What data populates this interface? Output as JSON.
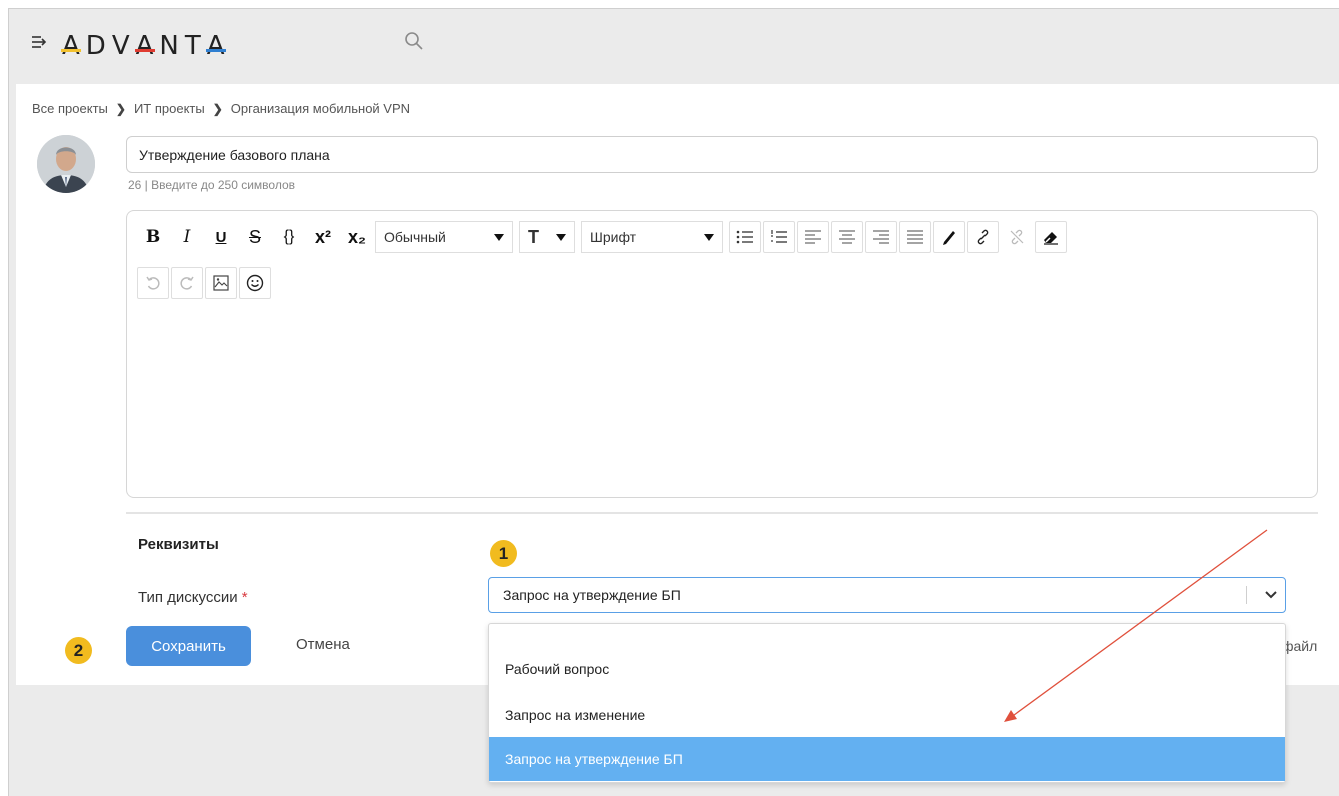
{
  "app": {
    "logo_text": "ADVANTA",
    "logo_letters": [
      "A",
      "D",
      "V",
      "A",
      "N",
      "T",
      "A"
    ]
  },
  "breadcrumb": {
    "items": [
      "Все проекты",
      "ИТ проекты",
      "Организация мобильной VPN"
    ],
    "separator": "❯"
  },
  "form": {
    "title_value": "Утверждение базового плана",
    "counter_text": "26 | Введите до 250 символов"
  },
  "editor": {
    "toolbar": {
      "bold": "B",
      "italic": "I",
      "underline": "U",
      "strike": "S",
      "code": "{}",
      "superscript": "x²",
      "subscript": "x₂",
      "paragraph_select": "Обычный",
      "font_size_label": "T",
      "font_select": "Шрифт"
    }
  },
  "requisites": {
    "heading": "Реквизиты",
    "type_label": "Тип дискуссии",
    "required_mark": "*",
    "type_value": "Запрос на утверждение БП"
  },
  "dropdown": {
    "options": [
      "Рабочий вопрос",
      "Запрос на изменение",
      "Запрос на утверждение БП"
    ],
    "selected_index": 2
  },
  "actions": {
    "save_label": "Сохранить",
    "cancel_label": "Отмена",
    "attach_partial": "файл"
  },
  "annotations": {
    "badge_1": "1",
    "badge_2": "2"
  },
  "colors": {
    "accent": "#4a8fdc",
    "selected_option": "#63b0f1",
    "badge": "#f1bb1f",
    "logo_yellow": "#f2c12e",
    "logo_red": "#e03c31",
    "logo_blue": "#2f7fd1",
    "annotation_arrow": "#e0503c"
  }
}
